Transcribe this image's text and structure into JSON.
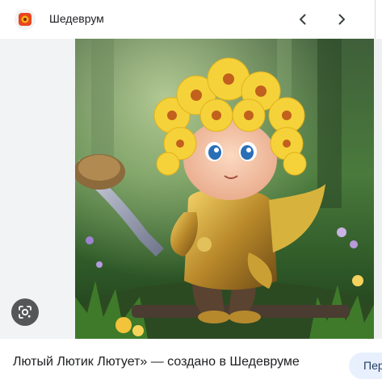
{
  "header": {
    "app_title": "Шедеврум",
    "app_icon": "shedevrum-logo-icon",
    "prev_icon": "chevron-left-icon",
    "next_icon": "chevron-right-icon"
  },
  "preview": {
    "lens_icon": "google-lens-icon",
    "image_subject": "golden armored chibi warrior with yellow flower hair"
  },
  "caption": {
    "text": "Лютый Лютик Лютует» — создано в Шедевруме"
  },
  "actions": {
    "share_label": "Пер"
  }
}
